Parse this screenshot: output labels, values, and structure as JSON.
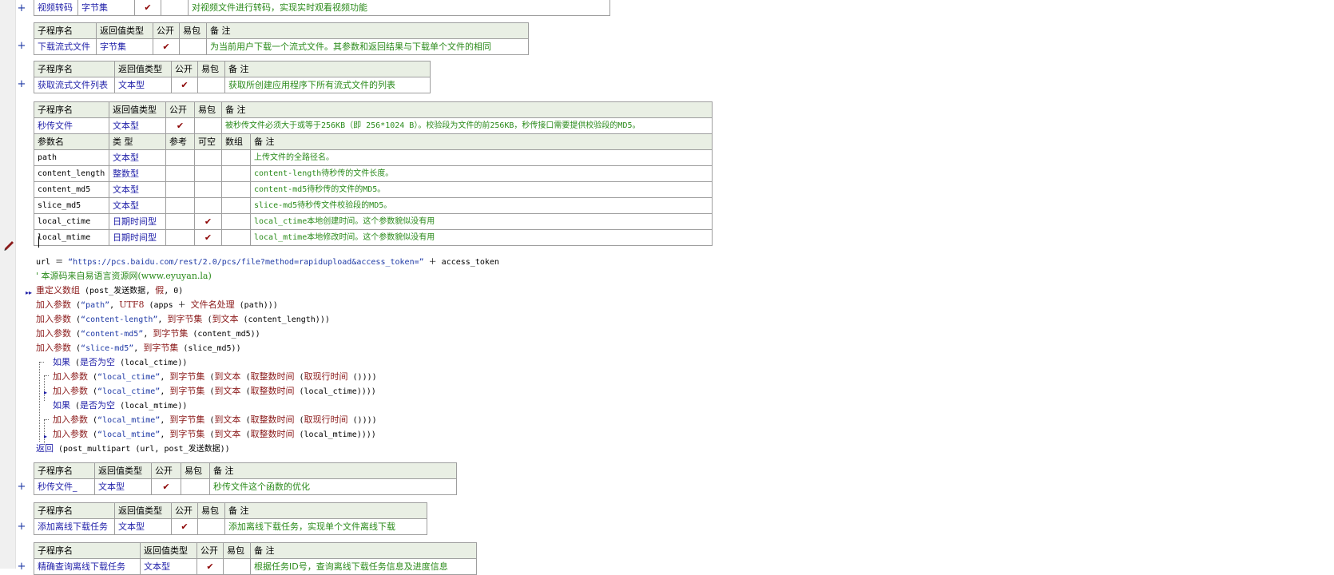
{
  "headers": {
    "sub_name": "子程序名",
    "ret_type": "返回值类型",
    "public": "公开",
    "easy_pkg": "易包",
    "remark": "备 注",
    "param_name": "参数名",
    "type": "类 型",
    "ref": "参考",
    "nullable": "可空",
    "array": "数组"
  },
  "check_mark": "✔",
  "expand_label": "+",
  "subs": [
    {
      "name": "视频转码",
      "type": "字节集",
      "public": true,
      "remark": "对视频文件进行转码，实现实时观看视频功能"
    },
    {
      "name": "下载流式文件",
      "type": "字节集",
      "public": true,
      "remark": "为当前用户下载一个流式文件。其参数和返回结果与下载单个文件的相同"
    },
    {
      "name": "获取流式文件列表",
      "type": "文本型",
      "public": true,
      "remark": "获取所创建应用程序下所有流式文件的列表"
    },
    {
      "name": "秒传文件",
      "type": "文本型",
      "public": true,
      "remark": "被秒传文件必须大于或等于256KB（即 256*1024 B）。校验段为文件的前256KB，秒传接口需要提供校验段的MD5。"
    },
    {
      "name": "秒传文件_",
      "type": "文本型",
      "public": true,
      "remark": "秒传文件这个函数的优化"
    },
    {
      "name": "添加离线下载任务",
      "type": "文本型",
      "public": true,
      "remark": "添加离线下载任务，实现单个文件离线下载"
    },
    {
      "name": "精确查询离线下载任务",
      "type": "文本型",
      "public": true,
      "remark": "根据任务ID号，查询离线下载任务信息及进度信息"
    }
  ],
  "params": [
    {
      "name": "path",
      "type": "文本型",
      "nullable": false,
      "remark": "上传文件的全路径名。"
    },
    {
      "name": "content_length",
      "type": "整数型",
      "nullable": false,
      "remark": "content-length待秒传的文件长度。"
    },
    {
      "name": "content_md5",
      "type": "文本型",
      "nullable": false,
      "remark": "content-md5待秒传的文件的MD5。"
    },
    {
      "name": "slice_md5",
      "type": "文本型",
      "nullable": false,
      "remark": "slice-md5待秒传文件校验段的MD5。"
    },
    {
      "name": "local_ctime",
      "type": "日期时间型",
      "nullable": true,
      "remark": "local_ctime本地创建时间。这个参数貌似没有用"
    },
    {
      "name": "local_mtime",
      "type": "日期时间型",
      "nullable": true,
      "remark": "local_mtime本地修改时间。这个参数貌似没有用"
    }
  ],
  "code": {
    "l1a": "url ＝ ",
    "l1b": "“https://pcs.baidu.com/rest/2.0/pcs/file?method=rapidupload&access_token=”",
    "l1c": " ＋ access_token",
    "l2": "' 本源码来自易语言资源网(www.eyuyan.la)",
    "l3a": "重定义数组",
    "l3b": " (post_发送数据, ",
    "l3c": "假",
    "l3d": ", 0)",
    "l4a": "加入参数",
    "l4b": " (",
    "l4c": "“path”",
    "l4d": ", ",
    "l4e": "UTF8",
    "l4f": " (apps ＋ ",
    "l4g": "文件名处理",
    "l4h": " (path)))",
    "l5a": "加入参数",
    "l5b": " (",
    "l5c": "“content-length”",
    "l5d": ", ",
    "l5e": "到字节集",
    "l5f": " (",
    "l5g": "到文本",
    "l5h": " (content_length)))",
    "l6a": "加入参数",
    "l6b": " (",
    "l6c": "“content-md5”",
    "l6d": ", ",
    "l6e": "到字节集",
    "l6f": " (content_md5))",
    "l7a": "加入参数",
    "l7b": " (",
    "l7c": "“slice-md5”",
    "l7d": ", ",
    "l7e": "到字节集",
    "l7f": " (slice_md5))",
    "l8a": "如果",
    "l8b": " (",
    "l8c": "是否为空",
    "l8d": " (local_ctime))",
    "l9a": "加入参数",
    "l9b": " (",
    "l9c": "“local_ctime”",
    "l9d": ", ",
    "l9e": "到字节集",
    "l9f": " (",
    "l9g": "到文本",
    "l9h": " (",
    "l9i": "取整数时间",
    "l9j": " (",
    "l9k": "取现行时间",
    "l9l": " ())))",
    "l10a": "加入参数",
    "l10b": " (",
    "l10c": "“local_ctime”",
    "l10d": ", ",
    "l10e": "到字节集",
    "l10f": " (",
    "l10g": "到文本",
    "l10h": " (",
    "l10i": "取整数时间",
    "l10j": " (local_ctime))))",
    "l11a": "如果",
    "l11b": " (",
    "l11c": "是否为空",
    "l11d": " (local_mtime))",
    "l12a": "加入参数",
    "l12b": " (",
    "l12c": "“local_mtime”",
    "l12d": ", ",
    "l12e": "到字节集",
    "l12f": " (",
    "l12g": "到文本",
    "l12h": " (",
    "l12i": "取整数时间",
    "l12j": " (",
    "l12k": "取现行时间",
    "l12l": " ())))",
    "l13a": "加入参数",
    "l13b": " (",
    "l13c": "“local_mtime”",
    "l13d": ", ",
    "l13e": "到字节集",
    "l13f": " (",
    "l13g": "到文本",
    "l13h": " (",
    "l13i": "取整数时间",
    "l13j": " (local_mtime))))",
    "l14a": "返回",
    "l14b": " (post_multipart (url, post_发送数据))"
  },
  "icons": {
    "pencil": "pencil-icon",
    "fold_arrow": "fold-arrow-icon",
    "expand": "expand-plus-icon"
  }
}
